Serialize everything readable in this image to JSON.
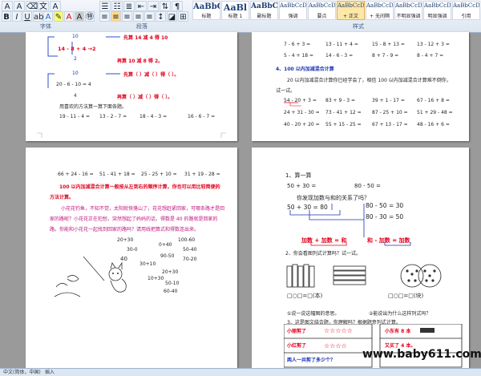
{
  "ribbon": {
    "group_font": "字体",
    "group_paragraph": "段落",
    "group_styles": "样式",
    "styles": [
      {
        "sample": "AaBbC",
        "name": "标题"
      },
      {
        "sample": "AaBl",
        "name": "标题 1"
      },
      {
        "sample": "AaBbC",
        "name": "副标题"
      },
      {
        "sample": "AaBbCcD",
        "name": "强调"
      },
      {
        "sample": "AaBbCcD",
        "name": "要点"
      },
      {
        "sample": "AaBbCcD",
        "name": "+ 正文"
      },
      {
        "sample": "AaBbCcD",
        "name": "+ 无间隔"
      },
      {
        "sample": "AaBbCcD",
        "name": "不明显强调"
      },
      {
        "sample": "AaBbCcD",
        "name": "明显强调"
      },
      {
        "sample": "AaBbCcD",
        "name": "引用"
      }
    ]
  },
  "page1": {
    "ex1_top": "10",
    "ex1_expr": "14 - 8 + 4 →2",
    "ex1_bottom": "2",
    "ex1_first": "先算 14 减 4 得 10",
    "ex1_then": "再算 10 减 8 得 2。",
    "ex2_top": "10",
    "ex2_expr": "20 - 6 - 10 = 4",
    "ex2_bottom": "4",
    "ex2_first": "先算（  ）减（  ）得（    ）。",
    "ex2_then": "再算（  ）减（  ）得（    ）。",
    "instruction": "用喜欢的方法算一算下面各题。",
    "problems": [
      "19 - 11 - 4 =",
      "13 - 2 - 7 =",
      "18 - 4 - 3 =",
      "16 - 6 - 7 ="
    ]
  },
  "page2": {
    "row1": [
      "7 - 6 + 3 =",
      "13 - 11 + 4 =",
      "15 - 8 + 13 =",
      "13 - 12 + 3 ="
    ],
    "row2": [
      "5 - 4 + 18 =",
      "14 - 6 - 3 =",
      "8 + 7 - 9 =",
      "8 - 4 + 7 ="
    ],
    "heading": "4、100 以内加减混合计算",
    "intro1": "20 以内加减混合计算你已经学会了，相信 100 以内加减混合计算难不倒你，",
    "intro2": "试一试。",
    "row3": [
      "54 - 20 + 3 =",
      "83 + 9 - 3 =",
      "39 + 1 - 17 =",
      "67 - 16 + 8 ="
    ],
    "row4": [
      "24 + 31 - 30 =",
      "73 - 41 + 12 =",
      "87 - 25 + 10 =",
      "51 + 29 - 48 ="
    ],
    "row5": [
      "40 - 20 + 20 =",
      "55 + 15 - 25 =",
      "67 + 13 - 17 =",
      "48 - 16 + 6 ="
    ]
  },
  "page3": {
    "row1": [
      "66 + 24 - 16 =",
      "51 - 41 + 18 =",
      "25 - 25 + 10 =",
      "31 + 19 - 28 ="
    ],
    "rule1": "100 以内加减混合计算一般按从左到右的顺序计算，你也可以用比较简便的",
    "rule2": "方法计算。",
    "story1": "小花花钓鱼，不知不觉，太阳就快落山了，花花想赶紧回家，可哪条路才是回",
    "story2": "家的路呢？小花花正在犯愁，突然想起了妈妈的话，得数是 40 的路就是回家的",
    "story3": "路。你能和小花花一起找到回家的路吗？请用线把算式和得数连出来。",
    "grid": [
      "20+30",
      "100-60",
      "30-0",
      "0+40",
      "40",
      "50-40",
      "90-50",
      "70-20",
      "30+10",
      "20+30",
      "10+30",
      "50-10",
      "60-40"
    ]
  },
  "page4": {
    "title": "1、算一算",
    "calc1": "50 + 30 =",
    "calc2": "80 - 50 =",
    "question": "你发现加数与和的关系了吗？",
    "eq1": "50 + 30 = 80",
    "eq2": "80 - 50 = 30",
    "eq3": "80 - 30 = 50",
    "rel1": "加数 + 加数 = 和",
    "rel2": "和 - 加数 = 加数",
    "task2": "2、你会看图列式计算吗？试一试。",
    "boxes": "□○□=□(本)",
    "boxes2": "□○□=□(块)",
    "q1": "①说一说这幅图的意思。",
    "q2": "②能说出为什么这样列式吗？",
    "task3": "3、这是图文结合题，你理解吗？根据题意列式计算。",
    "cell1": "小丽剪了",
    "cell2": "小红剪了",
    "cell3": "两人一共剪了多少个？",
    "cell4": "小东有 8 本",
    "cell5": "又买了 4 本。"
  },
  "watermark": "www.baby611.com",
  "status": {
    "lang": "中文(简体，中国)",
    "mode": "插入"
  }
}
